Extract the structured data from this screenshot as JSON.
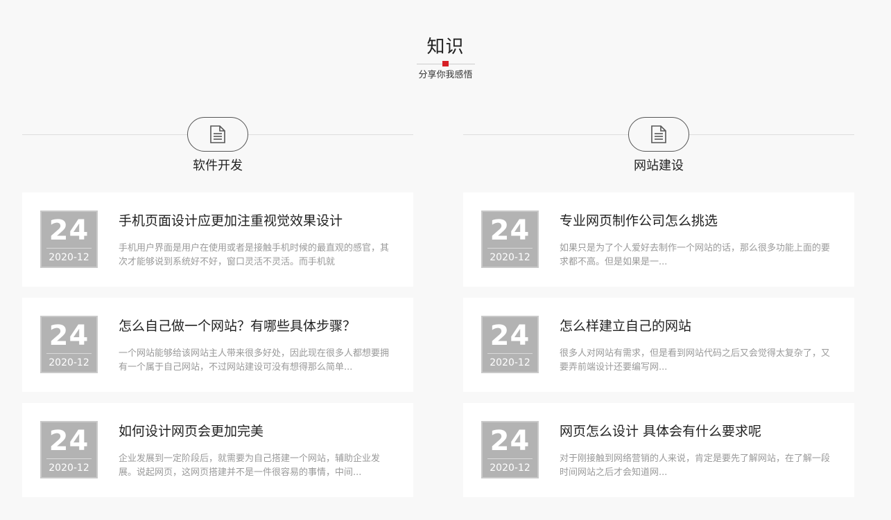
{
  "header": {
    "title": "知识",
    "subtitle": "分享你我感悟"
  },
  "accent_color": "#d71f26",
  "columns": [
    {
      "category": "软件开发",
      "icon": "document-icon",
      "articles": [
        {
          "day": "24",
          "month": "2020-12",
          "title": "手机页面设计应更加注重视觉效果设计",
          "summary": "手机用户界面是用户在使用或者是接触手机时候的最直观的感官，其次才能够说到系统好不好，窗口灵活不灵活。而手机就"
        },
        {
          "day": "24",
          "month": "2020-12",
          "title": "怎么自己做一个网站？有哪些具体步骤？",
          "summary": "一个网站能够给该网站主人带来很多好处，因此现在很多人都想要拥有一个属于自己网站，不过网站建设可没有想得那么简单..."
        },
        {
          "day": "24",
          "month": "2020-12",
          "title": "如何设计网页会更加完美",
          "summary": "企业发展到一定阶段后，就需要为自己搭建一个网站，辅助企业发展。说起网页，这网页搭建并不是一件很容易的事情，中间..."
        }
      ]
    },
    {
      "category": "网站建设",
      "icon": "document-icon",
      "articles": [
        {
          "day": "24",
          "month": "2020-12",
          "title": "专业网页制作公司怎么挑选",
          "summary": "如果只是为了个人爱好去制作一个网站的话，那么很多功能上面的要求都不高。但是如果是一..."
        },
        {
          "day": "24",
          "month": "2020-12",
          "title": "怎么样建立自己的网站",
          "summary": "很多人对网站有需求，但是看到网站代码之后又会觉得太复杂了，又要弄前端设计还要编写网..."
        },
        {
          "day": "24",
          "month": "2020-12",
          "title": "网页怎么设计 具体会有什么要求呢",
          "summary": "对于刚接触到网络营销的人来说，肯定是要先了解网站，在了解一段时间网站之后才会知道网..."
        }
      ]
    }
  ]
}
